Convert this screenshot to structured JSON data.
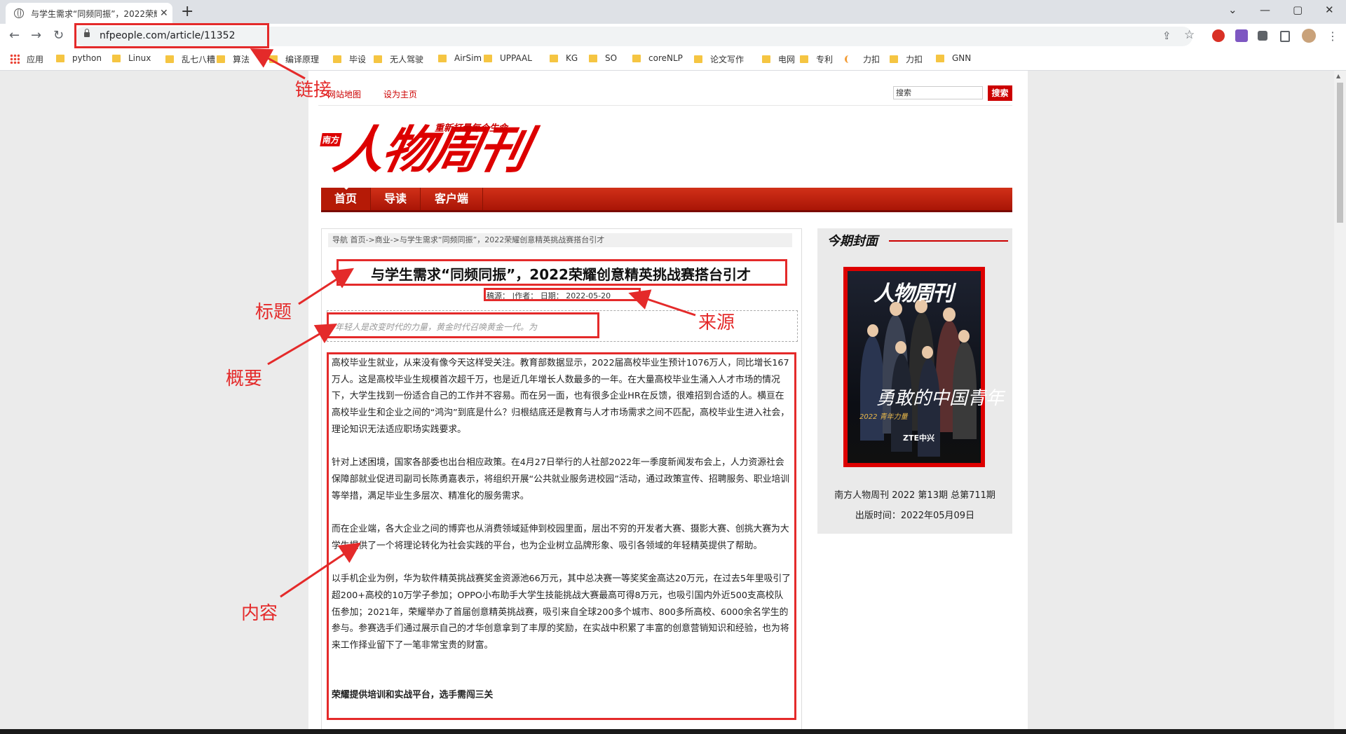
{
  "browser": {
    "tab_title": "与学生需求“同频同振”，2022荣耀",
    "tab_close": "✕",
    "newtab": "+",
    "url": "nfpeople.com/article/11352",
    "win_min": "—",
    "win_max": "▢",
    "win_close": "✕",
    "tab_menu": "⌄",
    "back": "←",
    "forward": "→",
    "reload": "↻",
    "share_icon": "⇪",
    "star_icon": "☆",
    "more_icon": "⋮"
  },
  "bookmarks": {
    "apps": "应用",
    "items": [
      "python",
      "Linux",
      "乱七八糟",
      "算法",
      "编译原理",
      "毕设",
      "无人驾驶",
      "AirSim",
      "UPPAAL",
      "KG",
      "SO",
      "coreNLP",
      "论文写作",
      "电网",
      "专利",
      "力扣",
      "力扣",
      "GNN"
    ]
  },
  "site": {
    "top_links": [
      "网站地图",
      "设为主页"
    ],
    "search_placeholder": "搜索",
    "search_button": "搜索",
    "logo_small": "南方",
    "logo_main": "人物周刊",
    "logo_slogan": "重新打量每个生命",
    "nav": [
      "首页",
      "导读",
      "客户端"
    ]
  },
  "article": {
    "breadcrumb": "导航 首页->商业->与学生需求“同频同振”，2022荣耀创意精英挑战赛搭台引才",
    "title": "与学生需求“同频同振”，2022荣耀创意精英挑战赛搭台引才",
    "meta": "稿源：   |作者：   日期：  2022-05-20",
    "summary": "年轻人是改变时代的力量，黄金时代召唤黄金一代。为",
    "paragraphs": [
      "高校毕业生就业，从来没有像今天这样受关注。教育部数据显示，2022届高校毕业生预计1076万人，同比增长167万人。这是高校毕业生规模首次超千万，也是近几年增长人数最多的一年。在大量高校毕业生涌入人才市场的情况下，大学生找到一份适合自己的工作并不容易。而在另一面，也有很多企业HR在反馈，很难招到合适的人。横亘在高校毕业生和企业之间的“鸿沟”到底是什么？归根结底还是教育与人才市场需求之间不匹配，高校毕业生进入社会，理论知识无法适应职场实践要求。",
      "针对上述困境，国家各部委也出台相应政策。在4月27日举行的人社部2022年一季度新闻发布会上，人力资源社会保障部就业促进司副司长陈勇嘉表示，将组织开展“公共就业服务进校园”活动，通过政策宣传、招聘服务、职业培训等举措，满足毕业生多层次、精准化的服务需求。",
      "而在企业端，各大企业之间的博弈也从消费领域延伸到校园里面，层出不穷的开发者大赛、摄影大赛、创挑大赛为大学生提供了一个将理论转化为社会实践的平台，也为企业树立品牌形象、吸引各领域的年轻精英提供了帮助。",
      "以手机企业为例，华为软件精英挑战赛奖金资源池66万元，其中总决赛一等奖奖金高达20万元，在过去5年里吸引了超200+高校的10万学子参加；OPPO小布助手大学生技能挑战大赛最高可得8万元，也吸引国内外近500支高校队伍参加；2021年，荣耀举办了首届创意精英挑战赛，吸引来自全球200多个城市、800多所高校、6000余名学生的参与。参赛选手们通过展示自己的才华创意拿到了丰厚的奖励，在实战中积累了丰富的创意营销知识和经验，也为将来工作择业留下了一笔非常宝贵的财富。"
    ],
    "subheading": "荣耀提供培训和实战平台，选手需闯三关"
  },
  "sidebar": {
    "title": "今期封面",
    "cover_logo": "人物周刊",
    "cover_text": "勇敢的中国青年",
    "cover_year": "2022 青年力量",
    "cover_brand": "ZTE中兴",
    "issue_line": "南方人物周刊 2022 第13期 总第711期",
    "date_line": "出版时间：2022年05月09日"
  },
  "annotations": {
    "link": "链接",
    "title": "标题",
    "source": "来源",
    "summary": "概要",
    "content": "内容"
  },
  "colors": {
    "accent_red": "#cc0000",
    "annotation_red": "#e42a2a",
    "nav_red": "#b51a06"
  }
}
